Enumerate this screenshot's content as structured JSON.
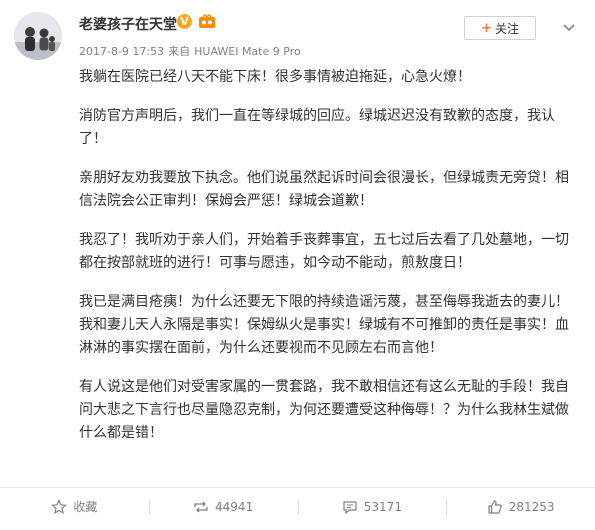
{
  "user": {
    "name": "老婆孩子在天堂",
    "verified_badge": "V",
    "meta": {
      "date": "2017-8-9 17:53",
      "source_prefix": "来自",
      "device": "HUAWEI Mate 9 Pro"
    }
  },
  "header": {
    "follow_label": "关注"
  },
  "post": {
    "paragraphs": [
      "我躺在医院已经八天不能下床！很多事情被迫拖延，心急火燎！",
      "消防官方声明后，我们一直在等绿城的回应。绿城迟迟没有致歉的态度，我认了！",
      "亲朋好友劝我要放下执念。他们说虽然起诉时间会很漫长，但绿城责无旁贷！相信法院会公正审判！保姆会严惩！绿城会道歉！",
      "我忍了！我听劝于亲人们，开始着手丧葬事宜，五七过后去看了几处墓地，一切都在按部就班的进行！可事与愿违，如今动不能动，煎敖度日！",
      "我已是满目疮痍！为什么还要无下限的持续造谣污蔑，甚至侮辱我逝去的妻儿！我和妻儿天人永隔是事实！保姆纵火是事实！绿城有不可推卸的责任是事实！血淋淋的事实摆在面前，为什么还要视而不见顾左右而言他！",
      "有人说这是他们对受害家属的一贯套路，我不敢相信还有这么无耻的手段！我自问大悲之下言行也尽量隐忍克制，为何还要遭受这种侮辱！？为什么我林生斌做什么都是错！"
    ]
  },
  "actions": {
    "favorite_label": "收藏",
    "repost_count": "44941",
    "comment_count": "53171",
    "like_count": "281253"
  },
  "colors": {
    "accent": "#fa7d3c",
    "badge": "#f5a623",
    "text": "#333333",
    "muted": "#808080"
  }
}
